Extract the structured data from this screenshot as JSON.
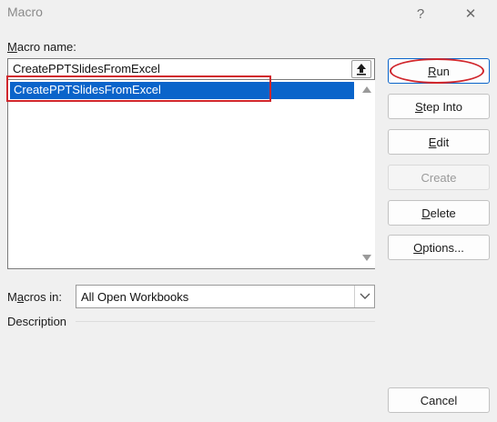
{
  "window": {
    "title": "Macro",
    "help_label": "?",
    "close_label": "✕"
  },
  "macro_name": {
    "label_underlined": "M",
    "label_rest": "acro name:",
    "value": "CreatePPTSlidesFromExcel"
  },
  "macro_list": {
    "items": [
      "CreatePPTSlidesFromExcel"
    ],
    "selected_index": 0
  },
  "buttons": {
    "run": {
      "underlined": "R",
      "rest": "un"
    },
    "step_into": {
      "underlined": "S",
      "rest": "tep Into"
    },
    "edit": {
      "underlined": "E",
      "rest": "dit"
    },
    "create": {
      "label": "Create"
    },
    "delete": {
      "underlined": "D",
      "rest": "elete"
    },
    "options": {
      "underlined": "O",
      "rest": "ptions..."
    },
    "cancel": {
      "label": "Cancel"
    }
  },
  "macros_in": {
    "label_before": "M",
    "label_underlined": "a",
    "label_after": "cros in:",
    "selected": "All Open Workbooks"
  },
  "description": {
    "label": "Description"
  },
  "colors": {
    "selection": "#0a64ca",
    "annotation": "#d0262c",
    "dialog_bg": "#f0f0f0"
  }
}
